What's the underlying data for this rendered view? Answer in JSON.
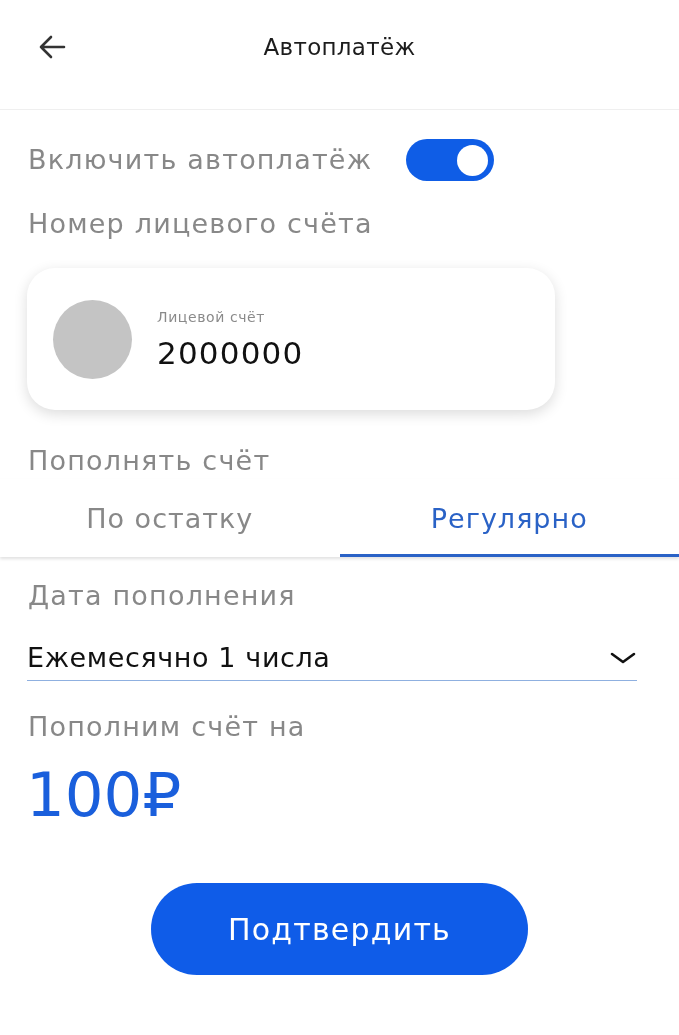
{
  "header": {
    "title": "Автоплатёж"
  },
  "autopay": {
    "label": "Включить автоплатёж",
    "on": true
  },
  "account": {
    "label": "Номер лицевого счёта",
    "card": {
      "caption": "Лицевой счёт",
      "number": "2000000"
    }
  },
  "top_up": {
    "label": "Пополнять счёт",
    "tabs": [
      {
        "label": "По остатку",
        "selected": false
      },
      {
        "label": "Регулярно",
        "selected": true
      }
    ]
  },
  "date": {
    "label": "Дата пополнения",
    "value": "Ежемесячно 1 числа"
  },
  "amount": {
    "label": "Пополним счёт на",
    "value": "100₽"
  },
  "confirm_button": {
    "label": "Подтвердить"
  }
}
